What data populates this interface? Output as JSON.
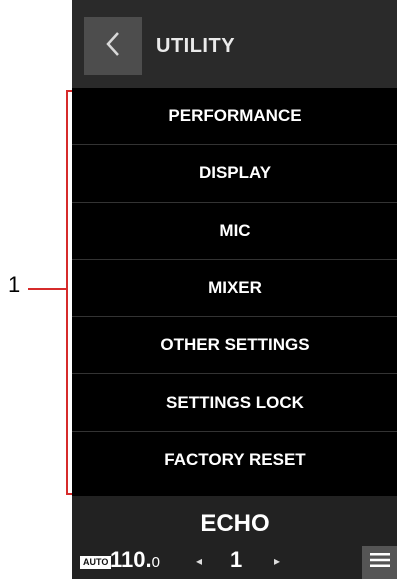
{
  "callout": {
    "number": "1"
  },
  "header": {
    "title": "UTILITY",
    "back_icon": "chevron-left-icon"
  },
  "menu": {
    "items": [
      {
        "label": "PERFORMANCE"
      },
      {
        "label": "DISPLAY"
      },
      {
        "label": "MIC"
      },
      {
        "label": "MIXER"
      },
      {
        "label": "OTHER SETTINGS"
      },
      {
        "label": "SETTINGS LOCK"
      },
      {
        "label": "FACTORY RESET"
      }
    ]
  },
  "footer": {
    "title": "ECHO",
    "auto_badge": "AUTO",
    "bpm_main": "110.",
    "bpm_decimal": "0",
    "beat_value": "1",
    "left_arrow": "◂",
    "right_arrow": "▸",
    "menu_icon": "hamburger-icon"
  },
  "colors": {
    "callout": "#d62b2b",
    "background": "#000000",
    "header": "#2a2a2a",
    "text": "#ffffff"
  }
}
